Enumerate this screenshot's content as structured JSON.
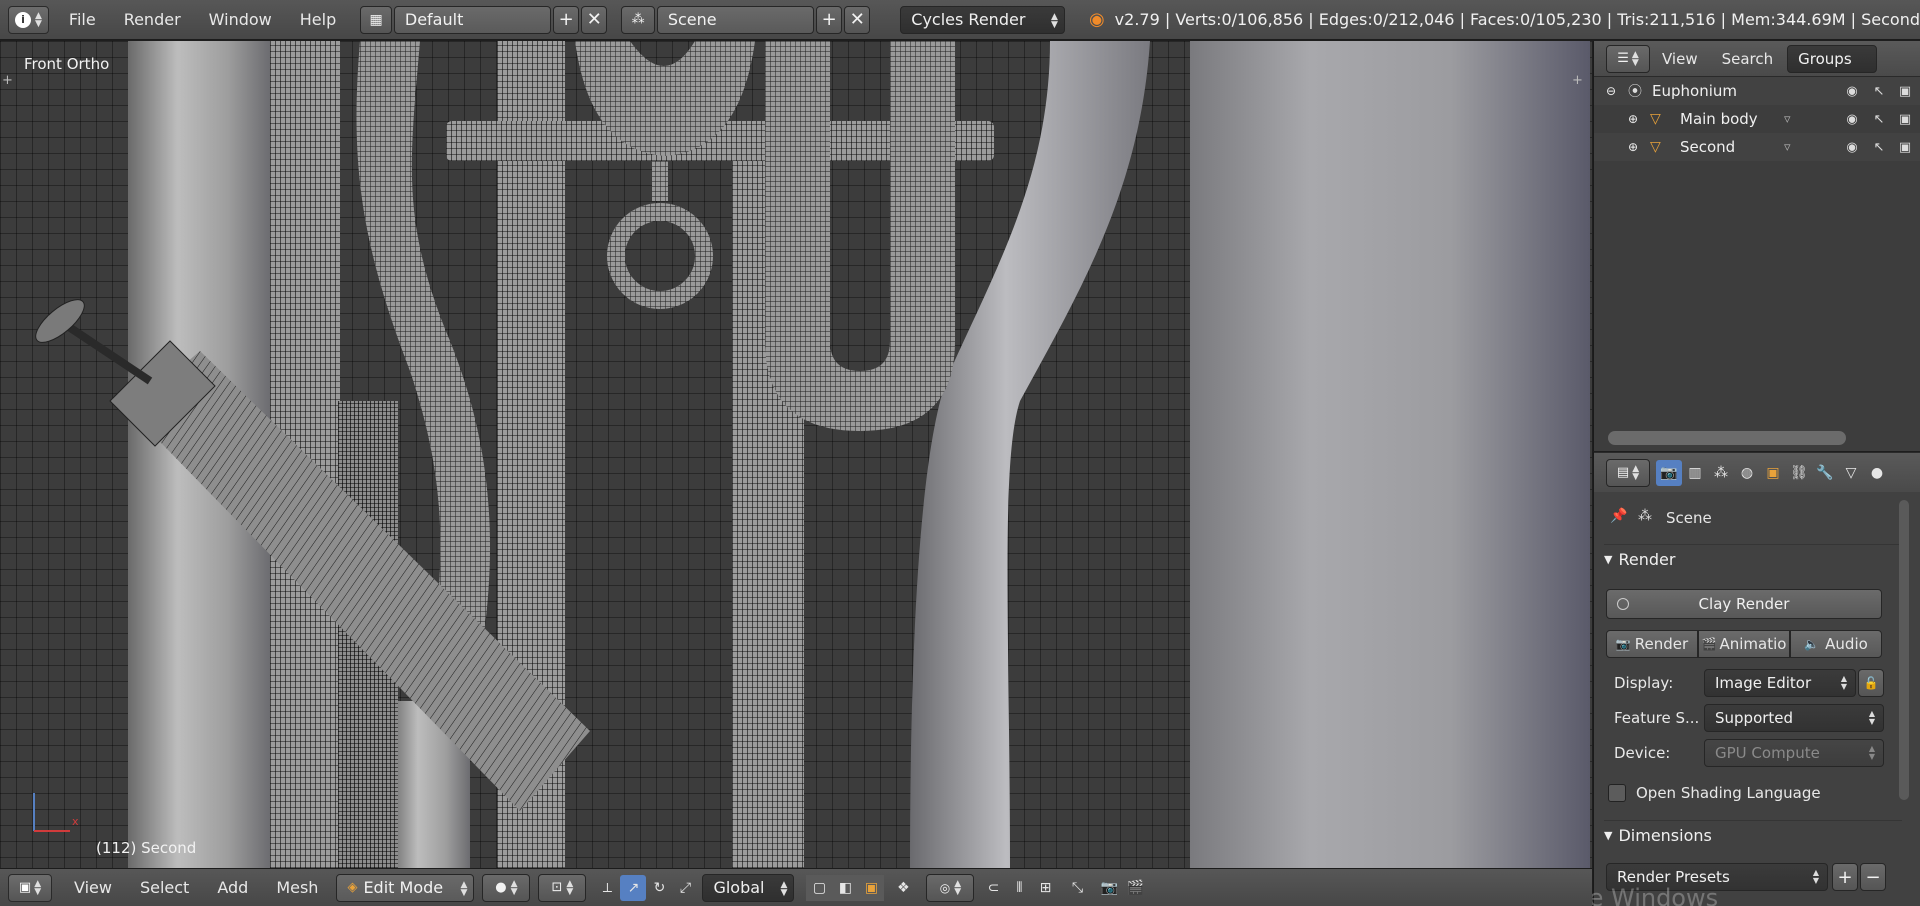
{
  "topbar": {
    "menus": [
      "File",
      "Render",
      "Window",
      "Help"
    ],
    "layout_name": "Default",
    "scene_name": "Scene",
    "render_engine": "Cycles Render",
    "stats": "v2.79 | Verts:0/106,856 | Edges:0/212,046 | Faces:0/105,230 | Tris:211,516 | Mem:344.69M | Second"
  },
  "viewport": {
    "view_label": "Front Ortho",
    "object_label": "(112) Second",
    "axis_x": "x",
    "watermark": "Activate Windows"
  },
  "outliner": {
    "header_items": [
      "View",
      "Search",
      "Groups"
    ],
    "rows": [
      {
        "label": "Euphonium"
      },
      {
        "label": "Main body"
      },
      {
        "label": "Second"
      }
    ]
  },
  "properties": {
    "scene_label": "Scene",
    "render_panel_title": "Render",
    "clay_render_label": "Clay Render",
    "render_buttons": [
      "Render",
      "Animatio",
      "Audio"
    ],
    "display_label": "Display:",
    "display_value": "Image Editor",
    "feature_label": "Feature S...",
    "feature_value": "Supported",
    "device_label": "Device:",
    "device_value": "GPU Compute",
    "osl_label": "Open Shading Language",
    "dimensions_title": "Dimensions",
    "render_presets_label": "Render Presets"
  },
  "bottombar": {
    "menus": [
      "View",
      "Select",
      "Add",
      "Mesh"
    ],
    "mode": "Edit Mode",
    "orientation": "Global"
  },
  "colors": {
    "accent_blue": "#5680c2",
    "mesh_orange": "#e8a23a",
    "header_gray": "#4f4f4f"
  }
}
